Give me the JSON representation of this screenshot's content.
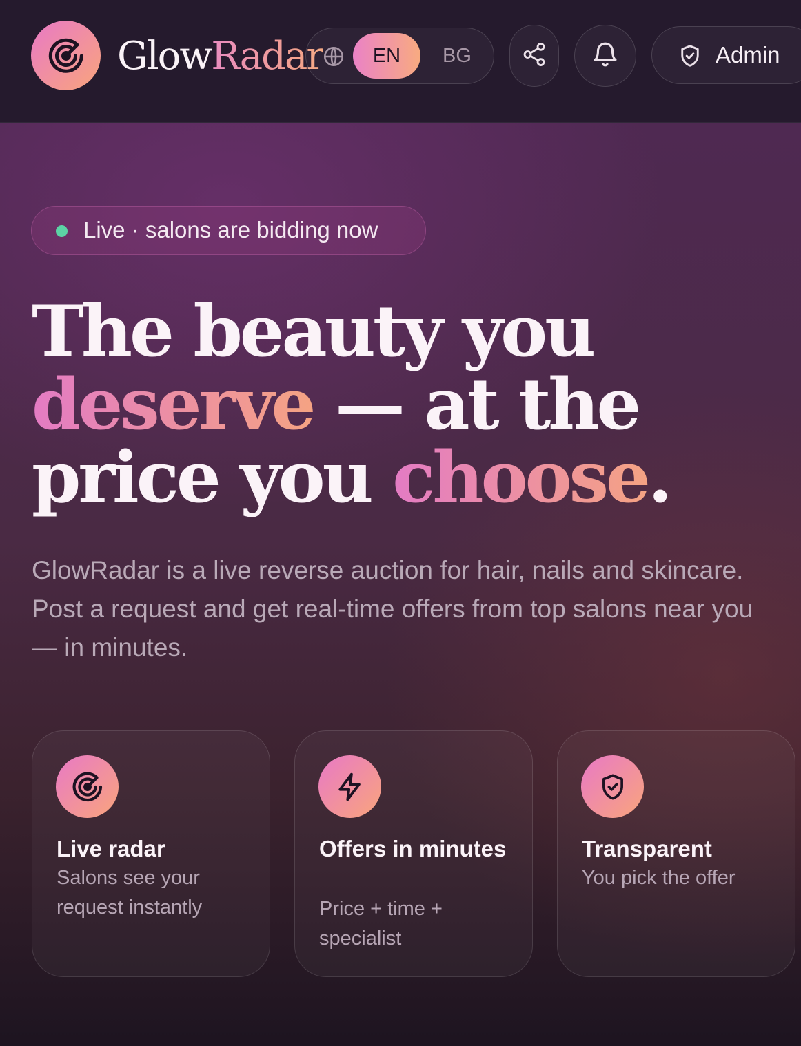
{
  "header": {
    "brand_part1": "Glow",
    "brand_part2": "Radar",
    "lang_en": "EN",
    "lang_bg": "BG",
    "admin_label": "Admin",
    "icons": [
      "radar-icon",
      "globe-icon",
      "share-icon",
      "bell-icon",
      "shield-check-icon"
    ]
  },
  "hero": {
    "live_badge": "Live · salons are bidding now",
    "headline_part1": "The beauty you ",
    "headline_accent1": "deserve",
    "headline_part2": " — at the price you ",
    "headline_accent2": "choose",
    "headline_end": ".",
    "lead": "GlowRadar is a live reverse auction for hair, nails and skincare. Post a request and get real-time offers from top salons near you — in minutes."
  },
  "features": [
    {
      "icon": "radar-icon",
      "title": "Live radar",
      "desc": "Salons see your request instantly"
    },
    {
      "icon": "lightning-icon",
      "title": "Offers in minutes",
      "desc": "Price + time + specialist"
    },
    {
      "icon": "shield-check-icon",
      "title": "Transparent",
      "desc": "You pick the offer"
    }
  ],
  "colors": {
    "accent_pink": "#e879c6",
    "accent_peach": "#f9a57c",
    "live_dot": "#5cd3a5",
    "topbar_bg": "#251a2d"
  }
}
